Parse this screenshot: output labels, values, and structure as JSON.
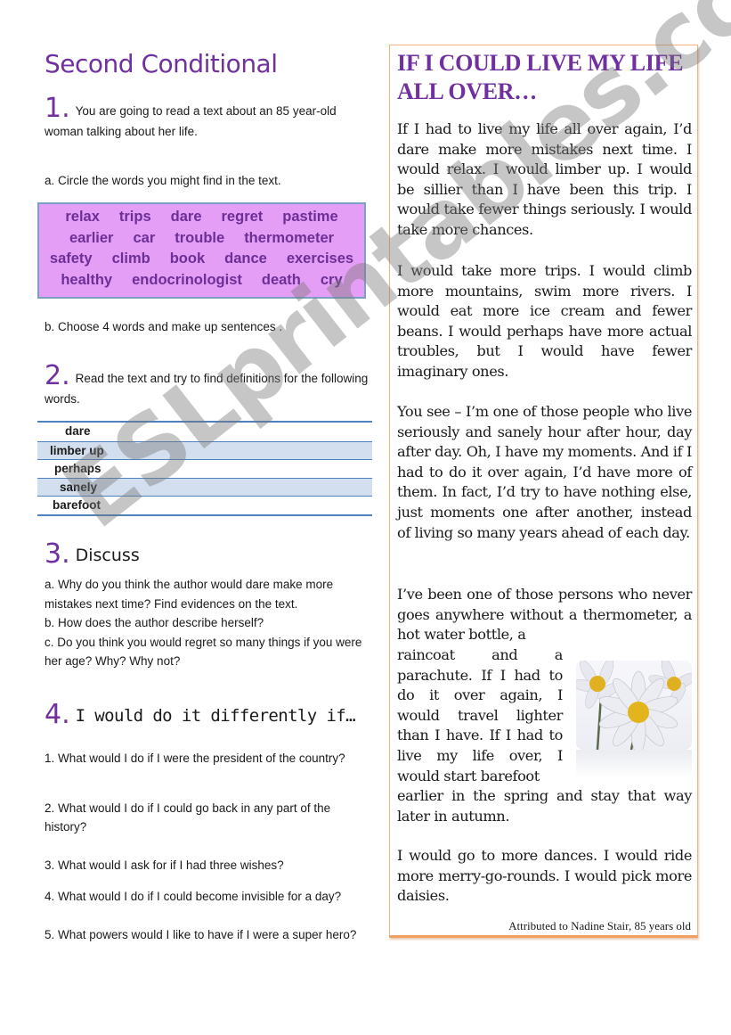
{
  "worksheet": {
    "title": "Second Conditional",
    "section1": {
      "number": "1.",
      "intro": "You are going to read a text about an 85 year-old woman talking about her life.",
      "task_a": "a. Circle the words you might find in the text.",
      "word_rows": [
        [
          "relax",
          "trips",
          "dare",
          "regret",
          "pastime"
        ],
        [
          "earlier",
          "car",
          "trouble",
          "thermometer"
        ],
        [
          "safety",
          "climb",
          "book",
          "dance",
          "exercises"
        ],
        [
          "healthy",
          "endocrinologist",
          "death",
          "cry"
        ]
      ],
      "task_b": "b. Choose 4 words and make up  sentences ."
    },
    "section2": {
      "number": "2.",
      "intro": "Read the text and try to find definitions for the following words.",
      "definition_words": [
        "dare",
        "limber up",
        "perhaps",
        "sanely",
        "barefoot"
      ]
    },
    "section3": {
      "number": "3.",
      "heading": "Discuss",
      "questions": [
        "a. Why do you think the author would dare make more mistakes next time? Find evidences on the text.",
        "b. How does the author describe herself?",
        "c. Do you think you would regret so many things if you were her age? Why? Why not?"
      ]
    },
    "section4": {
      "number": "4.",
      "heading": "I would do it differently if…",
      "questions": [
        "1. What would I do if I were the president of the country?",
        "2. What would I do if I could go back in any part of the history?",
        "3. What would I ask for if I had three wishes?",
        "4. What would I do if I could become invisible for a day?",
        "5. What powers would I like to have if I were a super hero?"
      ]
    }
  },
  "reading": {
    "title": "IF I COULD LIVE MY LIFE ALL OVER…",
    "paragraphs": [
      "If I had to live my life all over again, I’d dare make more mistakes next time. I would relax. I would limber up. I would be sillier than I have been this trip. I would take fewer things seriously. I would take more chances.",
      "I would take more trips. I would climb more mountains, swim more rivers. I would eat more ice cream and fewer beans. I would perhaps have more actual troubles, but I would have fewer imaginary ones.",
      "You see – I’m one of those people who live seriously and sanely hour after hour, day after day. Oh, I have my moments. And if I had to do it over again, I’d have more of them. In fact, I’d try to have nothing else, just moments one after another, instead of living so many years ahead of each day.",
      "I’ve been one of those persons who never goes anywhere without a thermometer, a hot water bottle, a",
      "raincoat and a parachute. If I had to do it over again, I would travel lighter than I have. If I had to live my life over, I would start barefoot",
      "earlier in the spring and stay that way later in autumn.",
      "I would go to more dances. I would ride more merry-go-rounds. I would pick more daisies."
    ],
    "attribution": "Attributed to Nadine Stair, 85 years old",
    "image_subject": "daisies"
  },
  "watermark": "ESLprintables.com",
  "colors": {
    "accent_purple": "#7030a0",
    "word_box_bg": "#e59ef5",
    "table_band": "#d3dfee",
    "table_rule": "#4f81bd",
    "box_border": "#f4b183"
  }
}
